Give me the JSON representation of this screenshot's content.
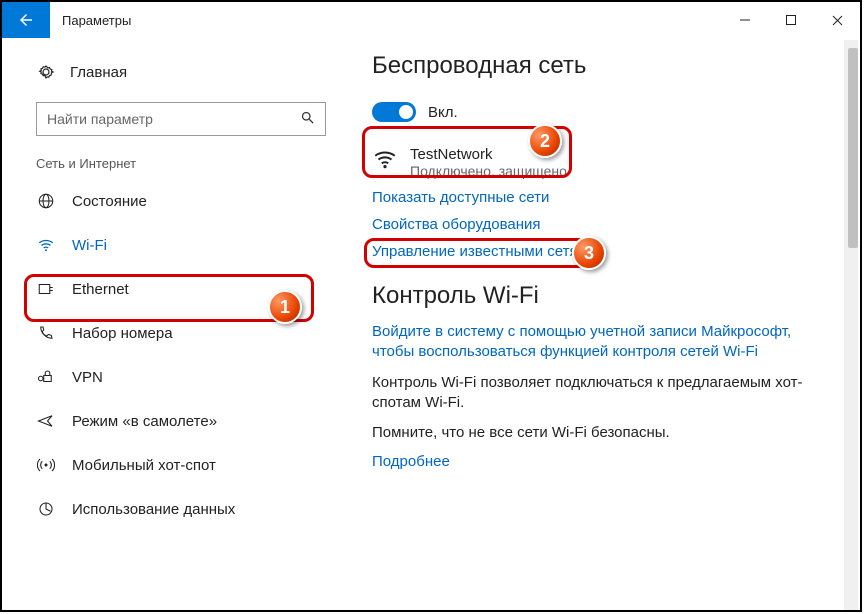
{
  "window": {
    "title": "Параметры"
  },
  "sidebar": {
    "home": "Главная",
    "search_placeholder": "Найти параметр",
    "category": "Сеть и Интернет",
    "items": [
      {
        "label": "Состояние"
      },
      {
        "label": "Wi-Fi"
      },
      {
        "label": "Ethernet"
      },
      {
        "label": "Набор номера"
      },
      {
        "label": "VPN"
      },
      {
        "label": "Режим «в самолете»"
      },
      {
        "label": "Мобильный хот-спот"
      },
      {
        "label": "Использование данных"
      }
    ]
  },
  "main": {
    "h1": "Беспроводная сеть",
    "toggle_label": "Вкл.",
    "network": {
      "name": "TestNetwork",
      "status": "Подключено, защищено"
    },
    "links": {
      "show_networks": "Показать доступные сети",
      "hw_props": "Свойства оборудования",
      "manage_known": "Управление известными сетями",
      "sign_in": "Войдите в систему с помощью учетной записи Майкрософт, чтобы воспользоваться функцией контроля сетей Wi-Fi",
      "more": "Подробнее"
    },
    "h2": "Контроль Wi-Fi",
    "para1": "Контроль Wi-Fi позволяет подключаться к предлагаемым хот-спотам Wi-Fi.",
    "para2": "Помните, что не все сети Wi-Fi безопасны."
  },
  "annotations": {
    "b1": "1",
    "b2": "2",
    "b3": "3"
  }
}
